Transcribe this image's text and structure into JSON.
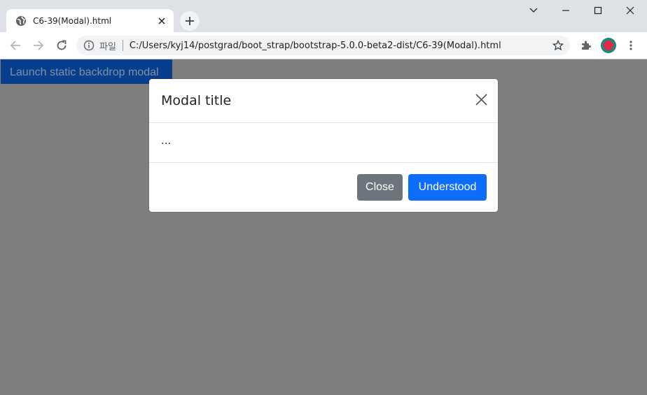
{
  "browser": {
    "tab_title": "C6-39(Modal).html",
    "scheme_label": "파일",
    "url": "C:/Users/kyj14/postgrad/boot_strap/bootstrap-5.0.0-beta2-dist/C6-39(Modal).html",
    "icons": [
      "globe-icon",
      "close-icon",
      "plus-icon",
      "chevron-down-icon",
      "minimize-icon",
      "maximize-icon",
      "window-close-icon",
      "back-arrow-icon",
      "forward-arrow-icon",
      "reload-icon",
      "info-icon",
      "star-icon",
      "puzzle-icon",
      "profile-avatar",
      "kebab-menu-icon"
    ]
  },
  "page": {
    "launch_button_label": "Launch static backdrop modal"
  },
  "modal": {
    "title": "Modal title",
    "body_text": "...",
    "close_button_label": "Close",
    "primary_button_label": "Understood"
  },
  "colors": {
    "backdrop": "#7f7f7f",
    "primary": "#0d6efd",
    "secondary": "#6c757d"
  }
}
